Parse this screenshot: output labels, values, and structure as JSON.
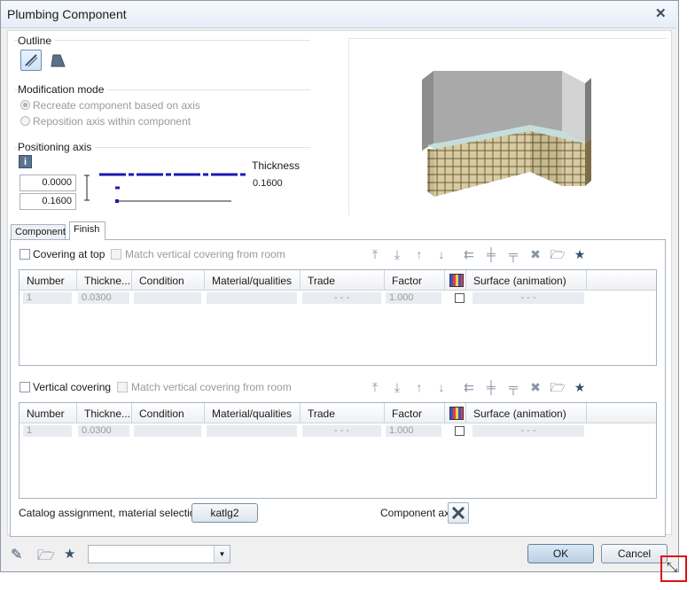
{
  "window": {
    "title": "Plumbing Component"
  },
  "outline": {
    "label": "Outline"
  },
  "modification": {
    "label": "Modification mode",
    "opt_recreate": "Recreate component based on axis",
    "opt_reposition": "Reposition axis within component"
  },
  "positioning": {
    "label": "Positioning axis",
    "value1": "0.0000",
    "value2": "0.1600",
    "thickness_label": "Thickness",
    "thickness_value": "0.1600"
  },
  "tabs": [
    "Component",
    "Finish"
  ],
  "top_section": {
    "covering_label": "Covering at top",
    "match_label": "Match vertical covering from room"
  },
  "vertical_section": {
    "covering_label": "Vertical covering",
    "match_label": "Match vertical covering from room"
  },
  "table_columns": [
    "Number",
    "Thickne...",
    "Condition",
    "Material/qualities",
    "Trade",
    "Factor",
    "Surface (animation)"
  ],
  "table_row": {
    "number": "1",
    "thickness": "0.0300",
    "trade": "- - -",
    "factor": "1.000",
    "surface": "- - -"
  },
  "bottom": {
    "catalog_label": "Catalog assignment, material selection",
    "catalog_button": "katlg2",
    "component_axis_label": "Component axis"
  },
  "footer": {
    "ok": "OK",
    "cancel": "Cancel",
    "combo_value": ""
  },
  "colors": {
    "axis_blue": "#1a1ab4",
    "highlight_red": "#e01010"
  }
}
